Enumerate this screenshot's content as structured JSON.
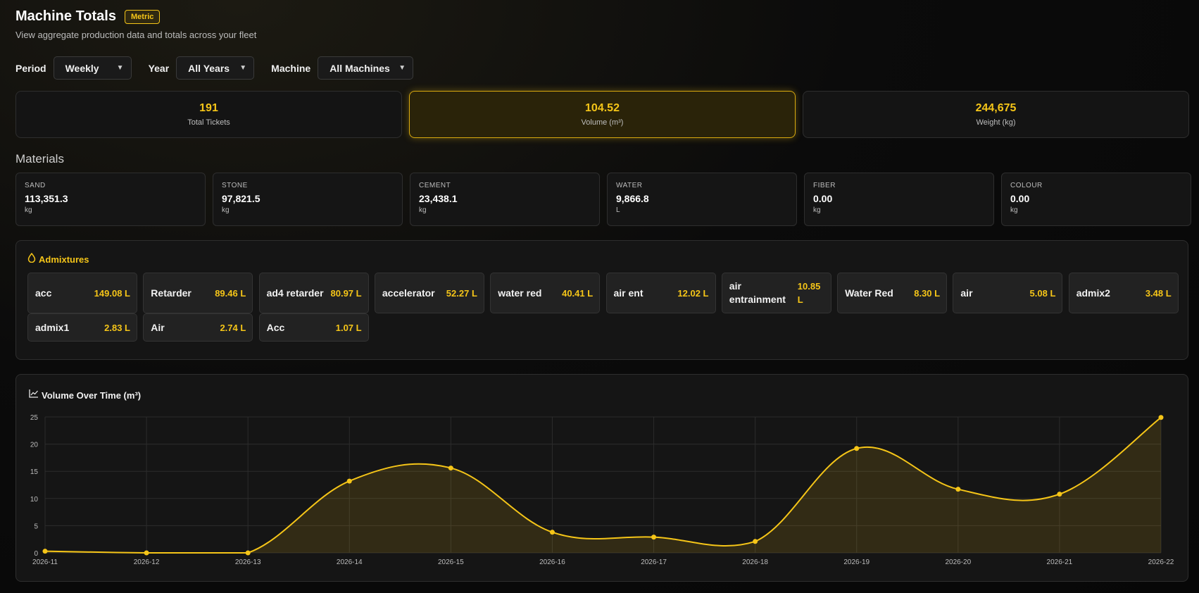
{
  "header": {
    "title": "Machine Totals",
    "badge": "Metric",
    "subtitle": "View aggregate production data and totals across your fleet"
  },
  "filters": {
    "period": {
      "label": "Period",
      "value": "Weekly"
    },
    "year": {
      "label": "Year",
      "value": "All Years"
    },
    "machine": {
      "label": "Machine",
      "value": "All Machines"
    }
  },
  "stats": [
    {
      "value": "191",
      "label": "Total Tickets"
    },
    {
      "value": "104.52",
      "label": "Volume (m³)"
    },
    {
      "value": "244,675",
      "label": "Weight (kg)"
    }
  ],
  "materials": {
    "title": "Materials",
    "items": [
      {
        "name": "SAND",
        "value": "113,351.3",
        "unit": "kg"
      },
      {
        "name": "STONE",
        "value": "97,821.5",
        "unit": "kg"
      },
      {
        "name": "CEMENT",
        "value": "23,438.1",
        "unit": "kg"
      },
      {
        "name": "WATER",
        "value": "9,866.8",
        "unit": "L"
      },
      {
        "name": "FIBER",
        "value": "0.00",
        "unit": "kg"
      },
      {
        "name": "COLOUR",
        "value": "0.00",
        "unit": "kg"
      }
    ]
  },
  "admixtures": {
    "title": "Admixtures",
    "icon": "droplet-icon",
    "items": [
      {
        "name": "acc",
        "value": "149.08 L"
      },
      {
        "name": "Retarder",
        "value": "89.46 L"
      },
      {
        "name": "ad4 retarder",
        "value": "80.97 L"
      },
      {
        "name": "accelerator",
        "value": "52.27 L"
      },
      {
        "name": "water red",
        "value": "40.41 L"
      },
      {
        "name": "air ent",
        "value": "12.02 L"
      },
      {
        "name": "air entrainment",
        "value": "10.85 L"
      },
      {
        "name": "Water Red",
        "value": "8.30 L"
      },
      {
        "name": "air",
        "value": "5.08 L"
      },
      {
        "name": "admix2",
        "value": "3.48 L"
      },
      {
        "name": "admix1",
        "value": "2.83 L"
      },
      {
        "name": "Air",
        "value": "2.74 L"
      },
      {
        "name": "Acc",
        "value": "1.07 L"
      }
    ]
  },
  "chart": {
    "title": "Volume Over Time (m³)",
    "icon": "line-chart-icon"
  },
  "colors": {
    "accent": "#f5c518",
    "panel": "#151515",
    "border": "#2e2e2e"
  },
  "chart_data": {
    "type": "area",
    "title": "Volume Over Time (m³)",
    "xlabel": "",
    "ylabel": "",
    "categories": [
      "2026-11",
      "2026-12",
      "2026-13",
      "2026-14",
      "2026-15",
      "2026-16",
      "2026-17",
      "2026-18",
      "2026-19",
      "2026-20",
      "2026-21",
      "2026-22"
    ],
    "values": [
      0.3,
      0.0,
      0.0,
      13.2,
      15.6,
      3.8,
      2.9,
      2.1,
      19.2,
      11.7,
      10.8,
      24.9
    ],
    "ylim": [
      0,
      25
    ],
    "yticks": [
      0,
      5,
      10,
      15,
      20,
      25
    ],
    "grid": true,
    "smooth": true
  }
}
